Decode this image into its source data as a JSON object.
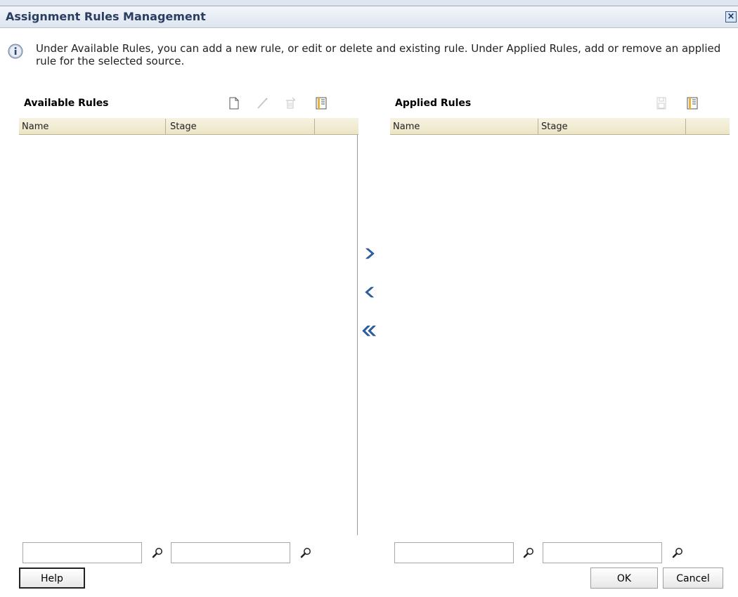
{
  "dialog": {
    "title": "Assignment Rules Management",
    "info": "Under Available Rules, you can add a new rule, or edit or delete and existing rule. Under Applied Rules, add or remove an applied rule for the selected source."
  },
  "available": {
    "title": "Available Rules",
    "columns": [
      "Name",
      "Stage"
    ],
    "rows": [],
    "toolbar": [
      "new-rule-icon",
      "edit-rule-icon",
      "delete-rule-icon",
      "detach-table-icon"
    ]
  },
  "applied": {
    "title": "Applied Rules",
    "columns": [
      "Name",
      "Stage"
    ],
    "rows": [],
    "toolbar": [
      "save-icon",
      "detach-table-icon"
    ]
  },
  "shuttle": [
    "move-right-icon",
    "move-left-icon",
    "move-all-left-icon"
  ],
  "filters": {
    "available_name": "",
    "available_stage": "",
    "applied_name": "",
    "applied_stage": ""
  },
  "buttons": {
    "help": "Help",
    "ok": "OK",
    "cancel": "Cancel"
  },
  "colors": {
    "title_text": "#2b3e62",
    "table_header": "#ece5c6",
    "shuttle_arrow": "#2d6fbf"
  }
}
